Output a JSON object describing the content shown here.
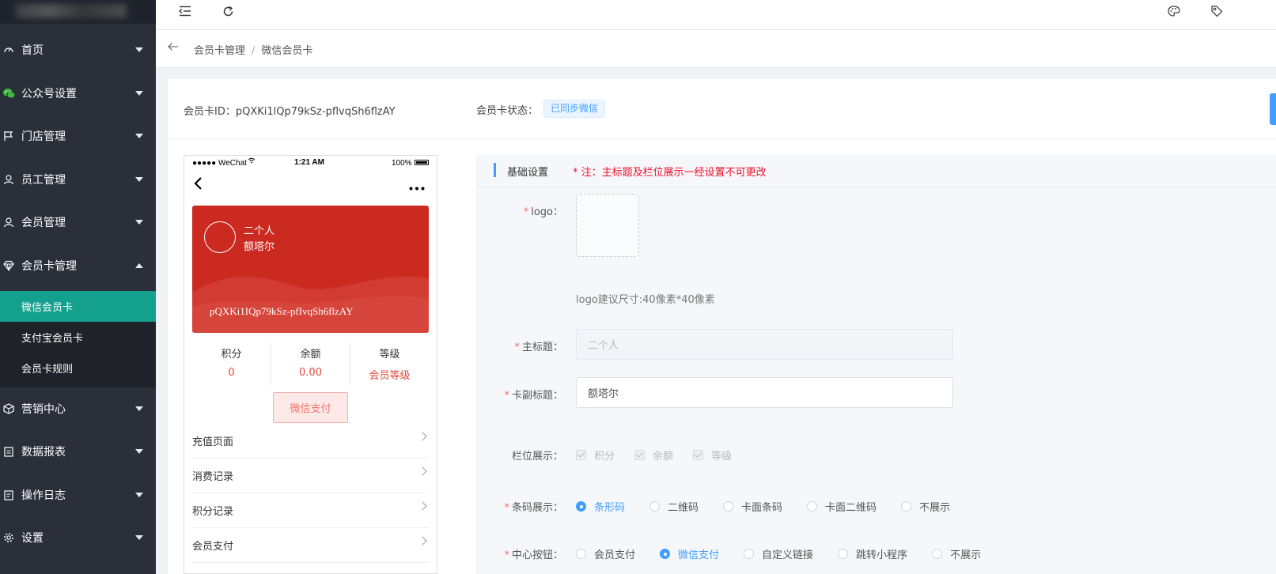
{
  "sidebar": {
    "items": [
      {
        "label": "首页",
        "icon": "dashboard-icon"
      },
      {
        "label": "公众号设置",
        "icon": "wechat-icon"
      },
      {
        "label": "门店管理",
        "icon": "flag-icon"
      },
      {
        "label": "员工管理",
        "icon": "user-icon"
      },
      {
        "label": "会员管理",
        "icon": "user-icon"
      },
      {
        "label": "会员卡管理",
        "icon": "diamond-icon"
      },
      {
        "label": "营销中心",
        "icon": "box-icon"
      },
      {
        "label": "数据报表",
        "icon": "report-icon"
      },
      {
        "label": "操作日志",
        "icon": "log-icon"
      },
      {
        "label": "设置",
        "icon": "gear-icon"
      }
    ],
    "submenu": [
      {
        "label": "微信会员卡",
        "active": true
      },
      {
        "label": "支付宝会员卡",
        "active": false
      },
      {
        "label": "会员卡规则",
        "active": false
      }
    ],
    "active_color": "#13a08c"
  },
  "breadcrumb": {
    "parent": "会员卡管理",
    "separator": "/",
    "current": "微信会员卡"
  },
  "card_header": {
    "id_label": "会员卡ID：pQXKi1lQp79kSz-pflvqSh6flzAY",
    "status_label": "会员卡状态：",
    "status_value": "已同步微信"
  },
  "phone": {
    "status_bar": {
      "carrier": "●●●●● WeChat",
      "time": "1:21 AM",
      "battery": "100%"
    },
    "card": {
      "title": "二个人",
      "subtitle": "额塔尔",
      "code": "pQXKi1IQp79kSz-pfIvqSh6flzAY",
      "color": "#cb2a20"
    },
    "stats": [
      {
        "label": "积分",
        "value": "0"
      },
      {
        "label": "余额",
        "value": "0.00"
      },
      {
        "label": "等级",
        "value": "会员等级"
      }
    ],
    "pay_button": "微信支付",
    "rows": [
      "充值页面",
      "消费记录",
      "积分记录",
      "会员支付"
    ]
  },
  "settings": {
    "section_title": "基础设置",
    "note": "*  注：主标题及栏位展示一经设置不可更改",
    "logo_label": "logo：",
    "logo_tip": "logo建议尺寸:40像素*40像素",
    "title_label": "主标题：",
    "title_value": "二个人",
    "subtitle_label": "卡副标题：",
    "subtitle_value": "额塔尔",
    "fields_label": "栏位展示：",
    "fields": [
      "积分",
      "余额",
      "等级"
    ],
    "barcode_label": "条码展示：",
    "barcode_options": [
      "条形码",
      "二维码",
      "卡面条码",
      "卡面二维码",
      "不展示"
    ],
    "barcode_selected": "条形码",
    "center_label": "中心按钮：",
    "center_options": [
      "会员支付",
      "微信支付",
      "自定义链接",
      "跳转小程序",
      "不展示"
    ],
    "center_selected": "微信支付"
  }
}
